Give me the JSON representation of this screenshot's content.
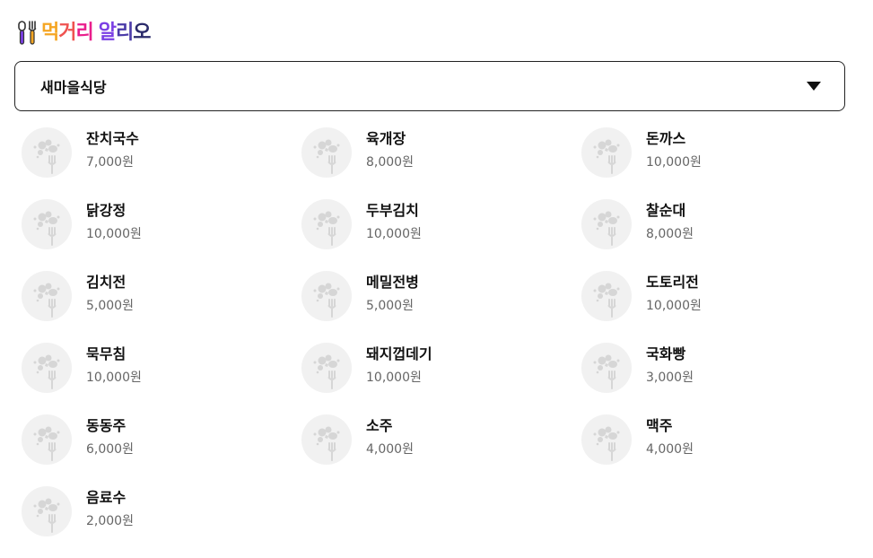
{
  "brand": {
    "logo_chars": [
      {
        "ch": "먹",
        "color": "#f5a623"
      },
      {
        "ch": "거",
        "color": "#ef5350"
      },
      {
        "ch": "리",
        "color": "#e91e8c"
      },
      {
        "ch": " ",
        "color": "#111111"
      },
      {
        "ch": "알",
        "color": "#7b3fe4"
      },
      {
        "ch": "리",
        "color": "#4a3aa8"
      },
      {
        "ch": "오",
        "color": "#2a2a6a"
      }
    ]
  },
  "restaurant_select": {
    "selected": "새마을식당",
    "icon": "caret-down-icon"
  },
  "menu": [
    {
      "name": "잔치국수",
      "price": "7,000원"
    },
    {
      "name": "육개장",
      "price": "8,000원"
    },
    {
      "name": "돈까스",
      "price": "10,000원"
    },
    {
      "name": "닭강정",
      "price": "10,000원"
    },
    {
      "name": "두부김치",
      "price": "10,000원"
    },
    {
      "name": "찰순대",
      "price": "8,000원"
    },
    {
      "name": "김치전",
      "price": "5,000원"
    },
    {
      "name": "메밀전병",
      "price": "5,000원"
    },
    {
      "name": "도토리전",
      "price": "10,000원"
    },
    {
      "name": "묵무침",
      "price": "10,000원"
    },
    {
      "name": "돼지껍데기",
      "price": "10,000원"
    },
    {
      "name": "국화빵",
      "price": "3,000원"
    },
    {
      "name": "동동주",
      "price": "6,000원"
    },
    {
      "name": "소주",
      "price": "4,000원"
    },
    {
      "name": "맥주",
      "price": "4,000원"
    },
    {
      "name": "음료수",
      "price": "2,000원"
    }
  ]
}
